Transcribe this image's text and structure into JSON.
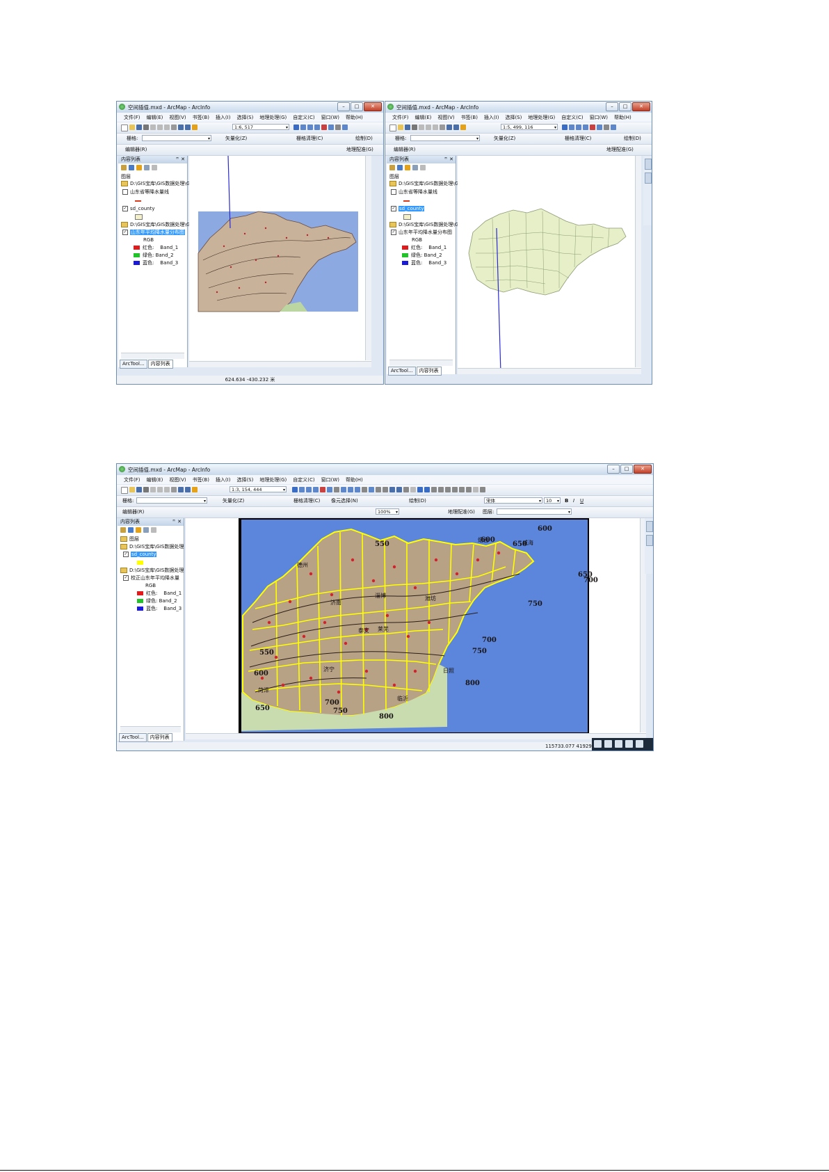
{
  "windows": {
    "top_left": {
      "title": "空间插值.mxd - ArcMap - ArcInfo",
      "scale": "1:6, 517",
      "scale_full": "1:6, 517",
      "layer_group_label": "图层",
      "toc_title": "内容列表",
      "path1": "D:\\GIS宝库\\GIS数据处理\\Gi",
      "layer_contour": "山东省等降水量线",
      "layer_county": "sd_county",
      "path2": "D:\\GIS宝库\\GIS数据处理\\G",
      "layer_raster": "山东年平均降水量分布图",
      "coords": "624.634  -430.232 米"
    },
    "top_right": {
      "title": "空间插值.mxd - ArcMap - ArcInfo",
      "scale": "1:5, 499, 116",
      "layer_group_label": "图层",
      "toc_title": "内容列表",
      "path1": "D:\\GIS宝库\\GIS数据处理\\Gi",
      "layer_contour": "山东省等降水量线",
      "layer_county": "sd_county",
      "path2": "D:\\GIS宝库\\GIS数据处理\\Gi",
      "layer_raster": "山东年平均降水量分布图"
    },
    "bottom": {
      "title": "空间插值.mxd - ArcMap - ArcInfo",
      "scale": "1:3, 154, 444",
      "layer_group_label": "图层",
      "toc_title": "内容列表",
      "path1": "D:\\GIS宝库\\GIS数据处理",
      "layer_county": "sd_county",
      "path2": "D:\\GIS宝库\\GIS数据处理",
      "layer_raster": "校正山东年平均降水量",
      "font": "宋体",
      "font_size": "10",
      "zoom": "100%",
      "coords": "115733.077  419290"
    }
  },
  "menu": [
    "文件(F)",
    "编辑(E)",
    "视图(V)",
    "书签(B)",
    "插入(I)",
    "选择(S)",
    "地理处理(G)",
    "自定义(C)",
    "窗口(W)",
    "帮助(H)"
  ],
  "toolbar": {
    "grid_label": "栅格:",
    "vectorize": "矢量化(Z)",
    "raster_clean": "栅格清理(C)",
    "draw": "绘制(D)",
    "editor": "编辑器(R)",
    "georef": "地理配准(G)",
    "layer_label": "图层:",
    "element_select": "像元选择(N)"
  },
  "legend": {
    "rgb": "RGB",
    "red": "红色:",
    "red_band": "Band_1",
    "green": "绿色:",
    "green_band": "Band_2",
    "blue": "蓝色:",
    "blue_band": "Band_3",
    "red_color": "#e11b1b",
    "green_color": "#22c22a",
    "blue_color": "#1a1ad8",
    "contour_color": "#d83a1a",
    "county_fill": "#f4f1c9"
  },
  "tabs": {
    "arctool": "ArcTool...",
    "toc": "内容列表"
  },
  "map_labels": {
    "contours": [
      "550",
      "600",
      "650",
      "600",
      "650",
      "700",
      "750",
      "700",
      "750",
      "800",
      "550",
      "600",
      "650",
      "700",
      "750",
      "800"
    ],
    "places": [
      "德州",
      "济南",
      "淄博",
      "潍坊",
      "烟台",
      "威海",
      "泰安",
      "莱芜",
      "济宁",
      "临沂",
      "日照",
      "菏泽"
    ]
  }
}
